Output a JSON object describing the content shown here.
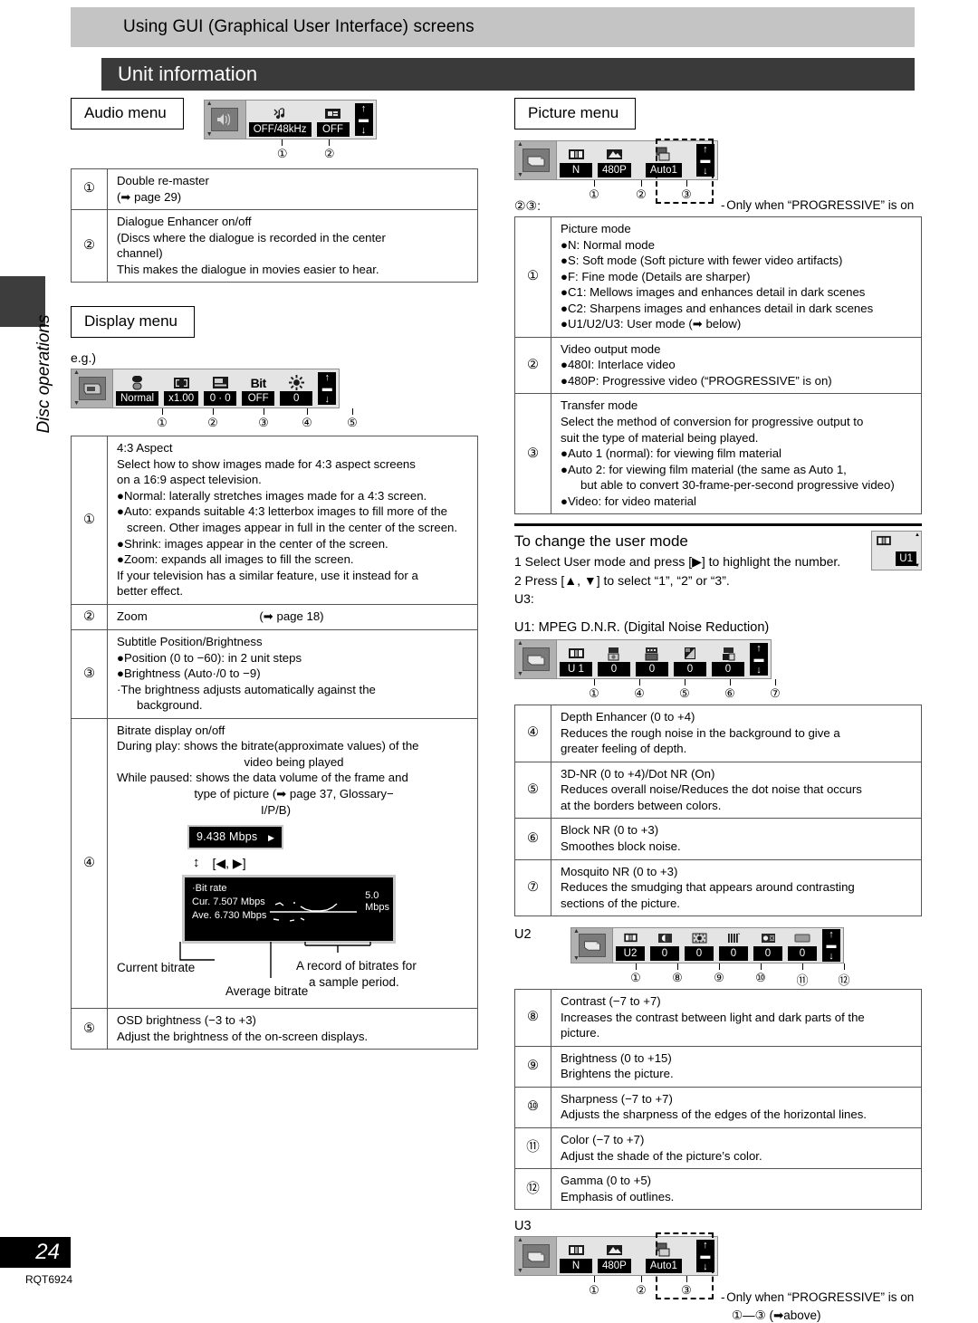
{
  "header": {
    "section_title": "Using GUI (Graphical User Interface) screens",
    "page_title": "Unit information"
  },
  "sidebar": {
    "tab_label": "Disc operations"
  },
  "footer": {
    "page_number": "24",
    "doc_code": "RQT6924"
  },
  "audio": {
    "caption": "Audio menu",
    "gui": {
      "icons": [
        "speaker-screen-icon",
        "music-note-icon",
        "dialogue-icon"
      ],
      "values": [
        "OFF/48kHz",
        "OFF"
      ],
      "callouts": [
        "①",
        "②"
      ]
    },
    "rows": [
      {
        "num": "①",
        "lines": [
          "Double re-master",
          "(➡ page 29)"
        ]
      },
      {
        "num": "②",
        "lines": [
          "Dialogue Enhancer on/off",
          "(Discs where the dialogue is recorded in the center",
          "channel)",
          "This makes the dialogue in movies easier to hear."
        ]
      }
    ]
  },
  "display": {
    "caption": "Display menu",
    "eg_label": "e.g.)",
    "gui": {
      "icons": [
        "display-screen-icon",
        "aspect-icon",
        "zoom-icon",
        "subtitle-icon",
        "bit-icon",
        "brightness-icon"
      ],
      "values": [
        "Normal",
        "x1.00",
        "0 · 0",
        "OFF",
        "0"
      ],
      "callouts": [
        "①",
        "②",
        "③",
        "④",
        "⑤"
      ]
    },
    "rows": [
      {
        "num": "①",
        "lines": [
          "4:3 Aspect",
          "Select how to show images made for 4:3 aspect screens",
          "on a 16:9 aspect television."
        ],
        "bullets": [
          "Normal:  laterally  stretches  images  made  for  a  4:3 screen.",
          "Auto:  expands suitable 4:3 letterbox images to fill more of the screen. Other images appear in full in the center of the screen.",
          "Shrink:  images appear in the center of the screen.",
          "Zoom:  expands all images to fill the screen."
        ],
        "tail": [
          "If your television has a similar feature, use it instead for a",
          "better effect."
        ]
      },
      {
        "num": "②",
        "label": "Zoom",
        "ref": "(➡ page 18)"
      },
      {
        "num": "③",
        "lines": [
          "Subtitle Position/Brightness"
        ],
        "bullets": [
          "Position (0 to −60): in 2 unit steps",
          "Brightness (Auto·/0 to −9)"
        ],
        "tail": [
          "·The brightness adjusts automatically against the",
          "background."
        ]
      },
      {
        "num": "④",
        "lines": [
          "Bitrate display on/off",
          "During play: shows the bitrate(approximate values) of the",
          "video being  played",
          "While paused: shows the data volume of the frame and",
          "type of picture (➡ page 37, Glossary−",
          "I/P/B)"
        ],
        "osd_top": "9.438 Mbps",
        "osd_key": "[◀, ▶]",
        "osd_title": "Bit rate",
        "osd_cur": "Cur.  7.507 Mbps",
        "osd_ave": "Ave.  6.730 Mbps",
        "osd_scale": "5.0",
        "osd_scale_unit": "Mbps",
        "label_current": "Current bitrate",
        "label_average": "Average bitrate",
        "label_record": [
          "A record of bitrates for",
          "a sample period."
        ]
      },
      {
        "num": "⑤",
        "lines": [
          "OSD brightness   (−3 to +3)",
          "Adjust the brightness of the on-screen displays."
        ]
      }
    ]
  },
  "picture": {
    "caption": "Picture menu",
    "gui": {
      "icons": [
        "picture-screen-icon",
        "picture-mode-icon",
        "video-output-icon",
        "transfer-mode-icon"
      ],
      "values": [
        "N",
        "480P",
        "Auto1"
      ],
      "callouts": [
        "①",
        "②",
        "③"
      ]
    },
    "progressive_note": "Only when “PROGRESSIVE” is on",
    "subheading": "②③:",
    "rows": [
      {
        "num": "①",
        "lines": [
          "Picture mode"
        ],
        "bullets": [
          "N:    Normal mode",
          "S:    Soft mode (Soft picture with fewer video artifacts)",
          "F:    Fine mode (Details are sharper)",
          "C1:  Mellows images and enhances detail in dark scenes",
          "C2:  Sharpens images and enhances detail in dark scenes",
          "U1/U2/U3: User mode (➡ below)"
        ]
      },
      {
        "num": "②",
        "lines": [
          " Video output mode"
        ],
        "bullets": [
          "480I:  Interlace video",
          "480P: Progressive video (“PROGRESSIVE” is on)"
        ]
      },
      {
        "num": "③",
        "lines": [
          "Transfer mode",
          "Select the method of conversion for progressive output to",
          "suit the type of material being played."
        ],
        "bullets": [
          "Auto 1 (normal):   for viewing film material",
          "Auto 2:  for viewing film material (the same as Auto 1,"
        ],
        "bullet_cont": "but able to convert 30-frame-per-second progressive video)",
        "bullets2": [
          "Video:  for video material"
        ]
      }
    ]
  },
  "user_mode": {
    "title": "To change the user mode",
    "steps": [
      "1 Select User mode and press [▶] to highlight the number.",
      "2 Press [▲, ▼] to select “1”, “2” or “3”."
    ],
    "u3_label": "U3:",
    "chip_value": "U1",
    "u1_heading": "U1: MPEG D.N.R. (Digital Noise Reduction)",
    "u1_gui": {
      "icons": [
        "picture-mode-icon",
        "depth-enhancer-icon",
        "3dnr-icon",
        "block-nr-icon",
        "mosquito-nr-icon"
      ],
      "values": [
        "U 1",
        "0",
        "0",
        "0",
        "0"
      ],
      "callouts": [
        "①",
        "④",
        "⑤",
        "⑥",
        "⑦"
      ]
    },
    "u1_rows": [
      {
        "num": "④",
        "lines": [
          "Depth Enhancer   (0 to +4)",
          "Reduces  the  rough  noise  in  the  background  to  give  a",
          "greater feeling of depth."
        ]
      },
      {
        "num": "⑤",
        "lines": [
          "3D-NR (0 to +4)/Dot NR (On)",
          "Reduces overall noise/Reduces the dot noise that occurs",
          "at the borders between colors."
        ]
      },
      {
        "num": "⑥",
        "lines": [
          "Block NR  (0 to +3)",
          "Smoothes block noise."
        ]
      },
      {
        "num": "⑦",
        "lines": [
          "Mosquito NR   (0 to +3)",
          "Reduces the smudging that appears around contrasting",
          "sections of the picture."
        ]
      }
    ],
    "u2_label": "U2",
    "u2_gui": {
      "icons": [
        "picture-mode-icon",
        "contrast-icon",
        "brightness-icon",
        "sharpness-icon",
        "color-icon",
        "gamma-icon"
      ],
      "values": [
        "U2",
        "0",
        "0",
        "0",
        "0",
        "0"
      ],
      "callouts": [
        "①",
        "⑧",
        "⑨",
        "⑩",
        "⑪",
        "⑫"
      ]
    },
    "u2_rows": [
      {
        "num": "⑧",
        "lines": [
          "Contrast   (−7 to +7)",
          "Increases the contrast between light and dark parts of the",
          "picture."
        ]
      },
      {
        "num": "⑨",
        "lines": [
          "Brightness   (0 to +15)",
          "Brightens the picture."
        ]
      },
      {
        "num": "⑩",
        "lines": [
          "Sharpness  (−7 to +7)",
          "Adjusts the sharpness of the edges of the horizontal lines."
        ]
      },
      {
        "num": "⑪",
        "lines": [
          "Color  (−7 to +7)",
          "Adjust the shade of the picture’s color."
        ]
      },
      {
        "num": "⑫",
        "lines": [
          "Gamma (0 to +5)",
          "Emphasis of outlines."
        ]
      }
    ],
    "u3_gui_label": "U3",
    "u3_gui": {
      "icons": [
        "picture-screen-icon",
        "picture-mode-icon",
        "video-output-icon",
        "transfer-mode-icon"
      ],
      "values": [
        "N",
        "480P",
        "Auto1"
      ],
      "callouts": [
        "①",
        "②",
        "③"
      ]
    },
    "u3_note": "Only when “PROGRESSIVE” is on",
    "u3_note2": "①—③ (➡above)"
  },
  "colors": {
    "band": "#c4c4c4",
    "title_bar": "#3a3a3a",
    "gui_bg": "#e4e4e4",
    "value_bg": "#000000"
  }
}
